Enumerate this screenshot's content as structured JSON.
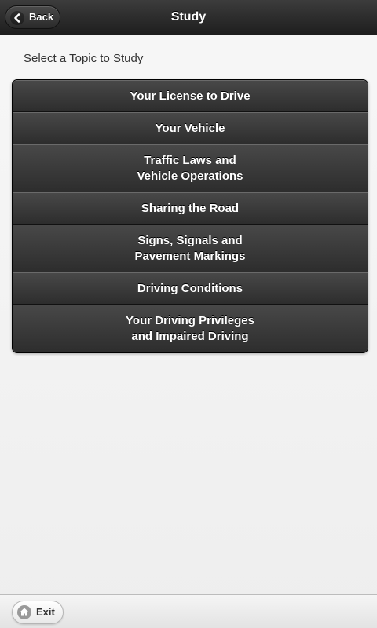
{
  "header": {
    "title": "Study",
    "back_label": "Back",
    "back_icon": "chevron-left-icon"
  },
  "prompt": "Select a Topic to Study",
  "topics": [
    "Your License to Drive",
    "Your Vehicle",
    "Traffic Laws and\nVehicle Operations",
    "Sharing the Road",
    "Signs, Signals and\nPavement Markings",
    "Driving Conditions",
    "Your Driving Privileges\nand Impaired Driving"
  ],
  "footer": {
    "exit_label": "Exit",
    "exit_icon": "home-icon"
  },
  "colors": {
    "header_bg": "#2b2b2b",
    "list_item_bg": "#3a3a3a",
    "page_bg": "#f2f2f2",
    "footer_bg": "#ececec"
  }
}
